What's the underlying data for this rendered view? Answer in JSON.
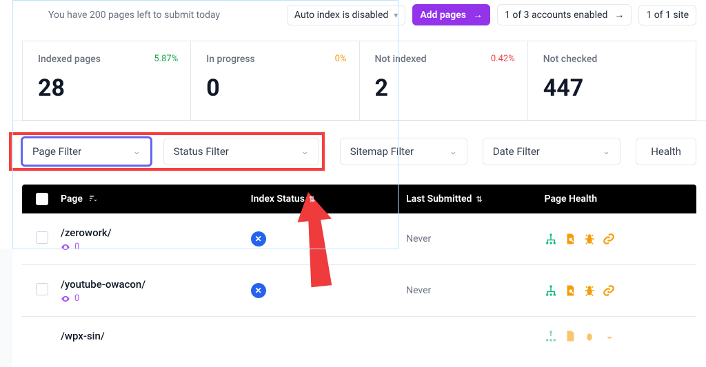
{
  "toolbar": {
    "quota": "You have 200 pages left to submit today",
    "auto_index": "Auto index is disabled",
    "add_pages": "Add pages",
    "accounts": "1 of 3 accounts enabled",
    "sites": "1 of 1 site"
  },
  "stats": [
    {
      "label": "Indexed pages",
      "value": "28",
      "pct": "5.87%",
      "pct_class": "green"
    },
    {
      "label": "In progress",
      "value": "0",
      "pct": "0%",
      "pct_class": "orange"
    },
    {
      "label": "Not indexed",
      "value": "2",
      "pct": "0.42%",
      "pct_class": "red"
    },
    {
      "label": "Not checked",
      "value": "447",
      "pct": "",
      "pct_class": ""
    }
  ],
  "filters": {
    "page": "Page Filter",
    "status": "Status Filter",
    "sitemap": "Sitemap Filter",
    "date": "Date Filter",
    "health": "Health"
  },
  "table": {
    "headers": {
      "page": "Page",
      "index": "Index Status",
      "last": "Last Submitted",
      "health": "Page Health"
    },
    "rows": [
      {
        "path": "/zerowork/",
        "views": "0",
        "last": "Never"
      },
      {
        "path": "/youtube-owacon/",
        "views": "0",
        "last": "Never"
      },
      {
        "path": "/wpx-sin/",
        "views": "",
        "last": ""
      }
    ]
  }
}
